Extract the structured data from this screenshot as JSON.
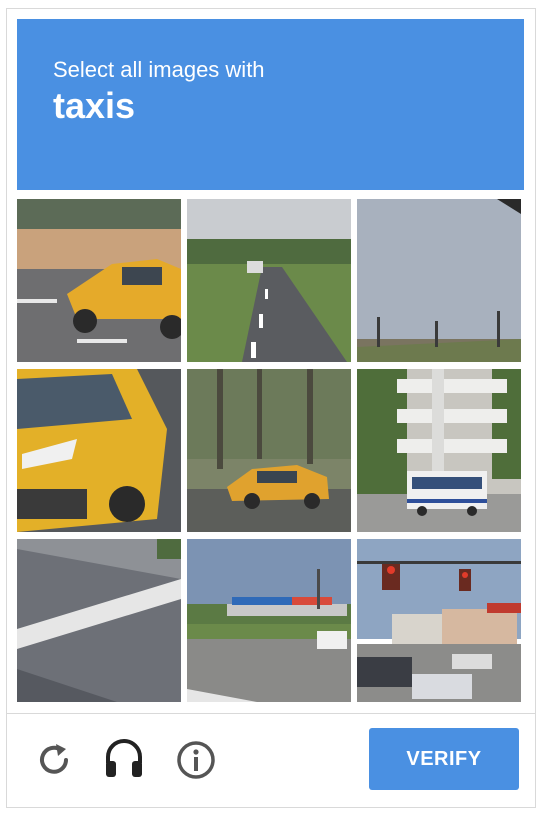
{
  "header": {
    "instruction": "Select all images with",
    "target": "taxis",
    "color": "#4a90e2"
  },
  "tiles": [
    {
      "subject": "yellow taxi on highway"
    },
    {
      "subject": "empty two-lane road"
    },
    {
      "subject": "sky with traffic lights"
    },
    {
      "subject": "yellow minivan taxi close-up"
    },
    {
      "subject": "yellow taxi among trees"
    },
    {
      "subject": "bus near parking garage"
    },
    {
      "subject": "road pavement with white line"
    },
    {
      "subject": "street with gas station"
    },
    {
      "subject": "intersection with traffic lights and cars"
    }
  ],
  "footer": {
    "reload_icon": "reload-icon",
    "audio_icon": "headphones-icon",
    "info_icon": "info-icon",
    "verify_label": "VERIFY"
  }
}
